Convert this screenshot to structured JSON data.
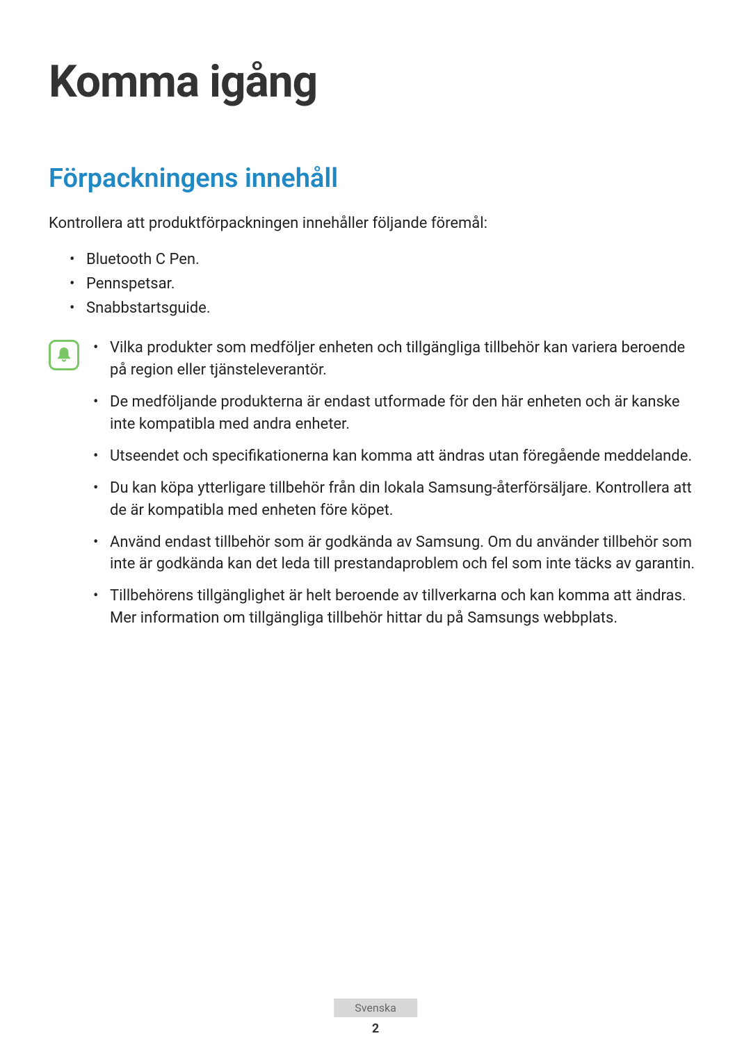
{
  "heading": "Komma igång",
  "section_heading": "Förpackningens innehåll",
  "intro": "Kontrollera att produktförpackningen innehåller följande föremål:",
  "items": [
    "Bluetooth C Pen.",
    "Pennspetsar.",
    "Snabbstartsguide."
  ],
  "notes": [
    "Vilka produkter som medföljer enheten och tillgängliga tillbehör kan variera beroende på region eller tjänsteleverantör.",
    "De medföljande produkterna är endast utformade för den här enheten och är kanske inte kompatibla med andra enheter.",
    "Utseendet och specifikationerna kan komma att ändras utan föregående meddelande.",
    "Du kan köpa ytterligare tillbehör från din lokala Samsung-återförsäljare. Kontrollera att de är kompatibla med enheten före köpet.",
    "Använd endast tillbehör som är godkända av Samsung. Om du använder tillbehör som inte är godkända kan det leda till prestandaproblem och fel som inte täcks av garantin.",
    "Tillbehörens tillgänglighet är helt beroende av tillverkarna och kan komma att ändras. Mer information om tillgängliga tillbehör hittar du på Samsungs webbplats."
  ],
  "footer": {
    "language": "Svenska",
    "page": "2"
  }
}
